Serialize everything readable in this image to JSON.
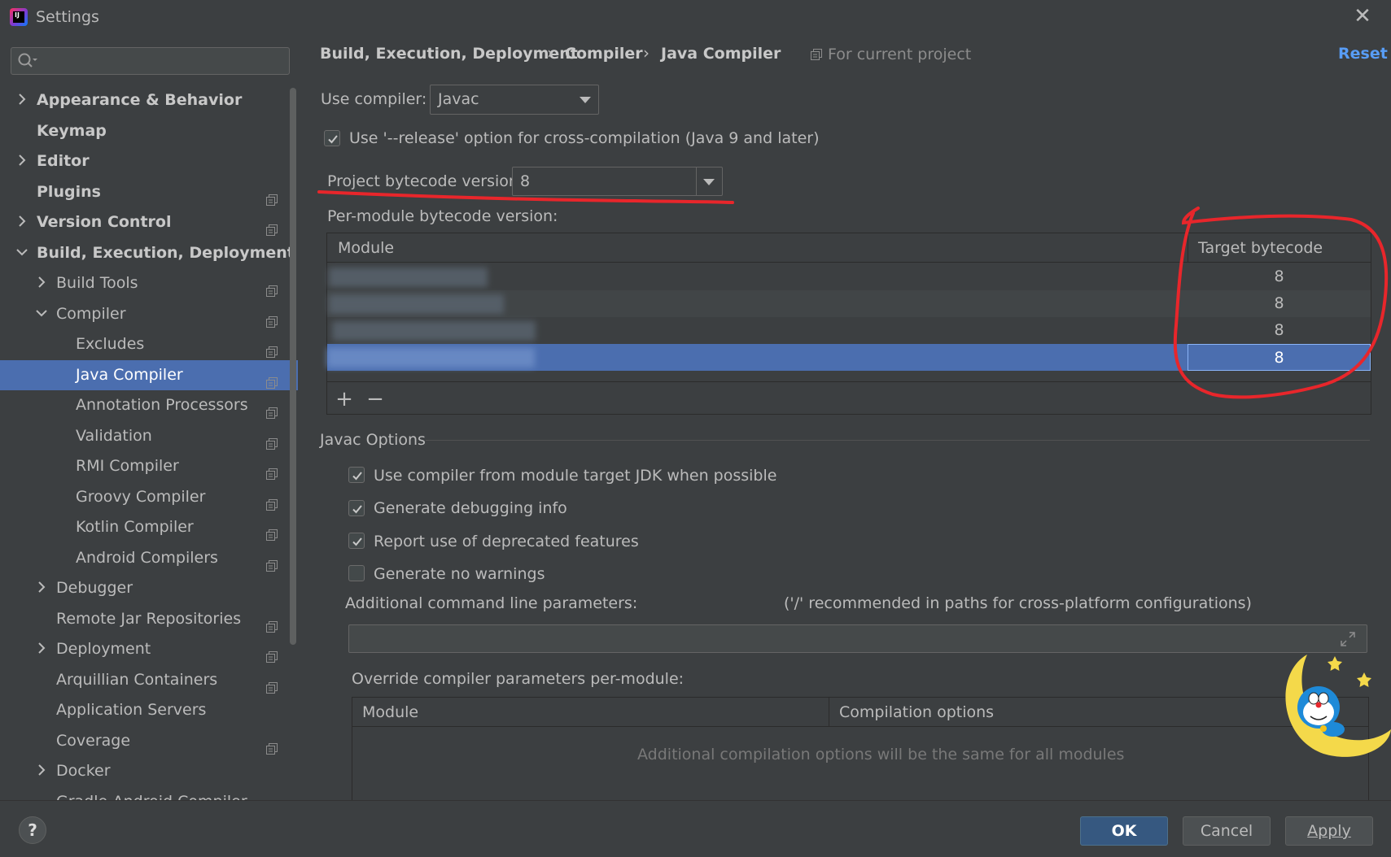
{
  "window": {
    "title": "Settings",
    "close_glyph": "✕"
  },
  "search": {
    "placeholder": ""
  },
  "tree": [
    {
      "label": "Appearance & Behavior",
      "level": 0,
      "arrow": "right",
      "bold": true,
      "copy": false
    },
    {
      "label": "Keymap",
      "level": 0,
      "arrow": "none",
      "bold": true,
      "copy": false
    },
    {
      "label": "Editor",
      "level": 0,
      "arrow": "right",
      "bold": true,
      "copy": false
    },
    {
      "label": "Plugins",
      "level": 0,
      "arrow": "none",
      "bold": true,
      "copy": true
    },
    {
      "label": "Version Control",
      "level": 0,
      "arrow": "right",
      "bold": true,
      "copy": true
    },
    {
      "label": "Build, Execution, Deployment",
      "level": 0,
      "arrow": "down",
      "bold": true,
      "copy": false
    },
    {
      "label": "Build Tools",
      "level": 1,
      "arrow": "right",
      "bold": false,
      "copy": true
    },
    {
      "label": "Compiler",
      "level": 1,
      "arrow": "down",
      "bold": false,
      "copy": true
    },
    {
      "label": "Excludes",
      "level": 2,
      "arrow": "none",
      "bold": false,
      "copy": true
    },
    {
      "label": "Java Compiler",
      "level": 2,
      "arrow": "none",
      "bold": false,
      "copy": true,
      "selected": true
    },
    {
      "label": "Annotation Processors",
      "level": 2,
      "arrow": "none",
      "bold": false,
      "copy": true
    },
    {
      "label": "Validation",
      "level": 2,
      "arrow": "none",
      "bold": false,
      "copy": true
    },
    {
      "label": "RMI Compiler",
      "level": 2,
      "arrow": "none",
      "bold": false,
      "copy": true
    },
    {
      "label": "Groovy Compiler",
      "level": 2,
      "arrow": "none",
      "bold": false,
      "copy": true
    },
    {
      "label": "Kotlin Compiler",
      "level": 2,
      "arrow": "none",
      "bold": false,
      "copy": true
    },
    {
      "label": "Android Compilers",
      "level": 2,
      "arrow": "none",
      "bold": false,
      "copy": true
    },
    {
      "label": "Debugger",
      "level": 1,
      "arrow": "right",
      "bold": false,
      "copy": false
    },
    {
      "label": "Remote Jar Repositories",
      "level": 1,
      "arrow": "none",
      "bold": false,
      "copy": true
    },
    {
      "label": "Deployment",
      "level": 1,
      "arrow": "right",
      "bold": false,
      "copy": true
    },
    {
      "label": "Arquillian Containers",
      "level": 1,
      "arrow": "none",
      "bold": false,
      "copy": true
    },
    {
      "label": "Application Servers",
      "level": 1,
      "arrow": "none",
      "bold": false,
      "copy": false
    },
    {
      "label": "Coverage",
      "level": 1,
      "arrow": "none",
      "bold": false,
      "copy": true
    },
    {
      "label": "Docker",
      "level": 1,
      "arrow": "right",
      "bold": false,
      "copy": false
    },
    {
      "label": "Gradle-Android Compiler",
      "level": 1,
      "arrow": "none",
      "bold": false,
      "copy": true
    }
  ],
  "breadcrumb": {
    "items": [
      "Build, Execution, Deployment",
      "Compiler",
      "Java Compiler"
    ],
    "separator": "›",
    "scope": "For current project",
    "reset": "Reset"
  },
  "compiler": {
    "use_compiler_label": "Use compiler:",
    "use_compiler_value": "Javac",
    "release_option_label": "Use '--release' option for cross-compilation (Java 9 and later)",
    "release_option_checked": true,
    "project_bytecode_label": "Project bytecode version:",
    "project_bytecode_value": "8",
    "per_module_label": "Per-module bytecode version:"
  },
  "module_table": {
    "columns": [
      "Module",
      "Target bytecode version"
    ],
    "rows": [
      {
        "module": "",
        "version": "8",
        "selected": false
      },
      {
        "module": "",
        "version": "8",
        "selected": false
      },
      {
        "module": "",
        "version": "8",
        "selected": false
      },
      {
        "module": "",
        "version": "8",
        "selected": true
      }
    ],
    "add_glyph": "+",
    "remove_glyph": "−"
  },
  "javac": {
    "section_title": "Javac Options",
    "options": [
      {
        "label": "Use compiler from module target JDK when possible",
        "checked": true
      },
      {
        "label": "Generate debugging info",
        "checked": true
      },
      {
        "label": "Report use of deprecated features",
        "checked": true
      },
      {
        "label": "Generate no warnings",
        "checked": false
      }
    ],
    "cmdline_label": "Additional command line parameters:",
    "cmdline_hint": "('/' recommended in paths for cross-platform configurations)",
    "cmdline_value": "",
    "override_label": "Override compiler parameters per-module:",
    "override_columns": [
      "Module",
      "Compilation options"
    ],
    "override_empty": "Additional compilation options will be the same for all modules"
  },
  "buttons": {
    "help": "?",
    "ok": "OK",
    "cancel": "Cancel",
    "apply": "Apply"
  },
  "colors": {
    "accent": "#4b6eaf",
    "link": "#589df6",
    "annotation": "#e8262b",
    "background": "#3c3f41"
  }
}
